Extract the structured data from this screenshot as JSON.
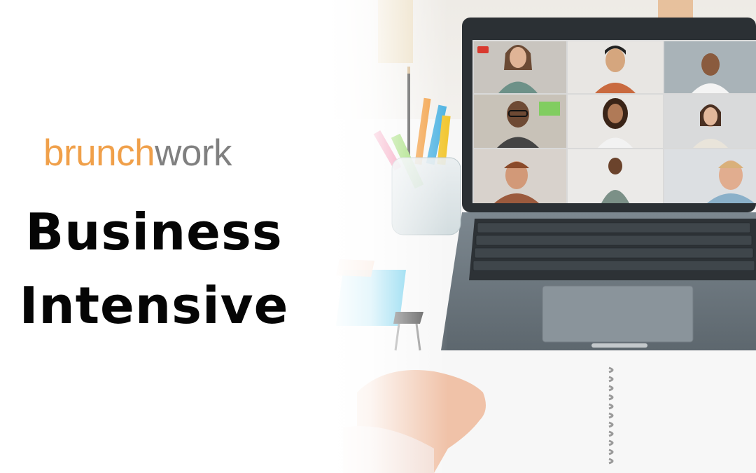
{
  "brand": {
    "part1": "brunch",
    "part2": "work",
    "color1": "#f0a04a",
    "color2": "#808080"
  },
  "headline": {
    "line1": "Business",
    "line2": "Intensive"
  },
  "photo": {
    "description_icon": "laptop-video-call-icon",
    "call_participants": 9
  }
}
